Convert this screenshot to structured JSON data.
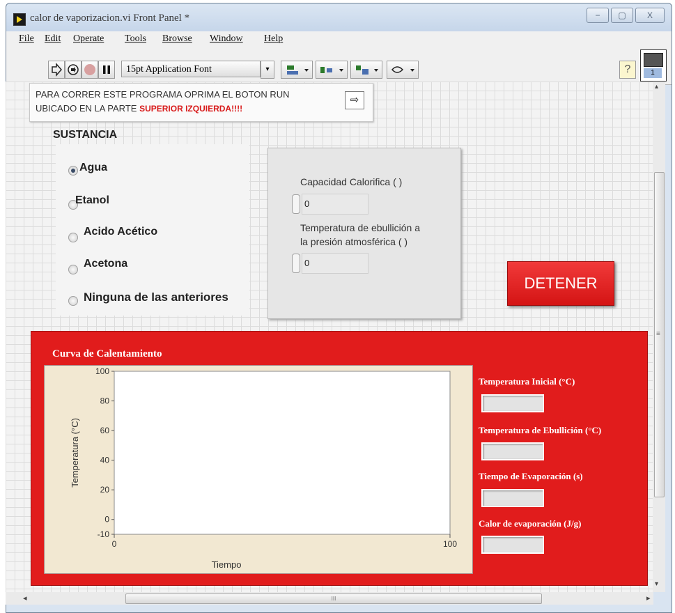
{
  "window": {
    "title": "calor de vaporizacion.vi Front Panel *",
    "controls": {
      "minimize": "−",
      "maximize": "▢",
      "close": "X"
    }
  },
  "menu": [
    "File",
    "Edit",
    "Operate",
    "Tools",
    "Browse",
    "Window",
    "Help"
  ],
  "toolbar": {
    "font_select": "15pt Application Font",
    "help_glyph": "?",
    "vi_icon_text": "1"
  },
  "instructions": {
    "line1": "PARA CORRER ESTE PROGRAMA OPRIMA EL BOTON RUN",
    "line2_prefix": "UBICADO EN LA PARTE ",
    "line2_highlight": "SUPERIOR IZQUIERDA!!!!",
    "arrow_glyph": "⇨"
  },
  "sustancia": {
    "title": "SUSTANCIA",
    "options": [
      "Agua",
      "Etanol",
      "Acido Acético",
      "Acetona",
      "Ninguna de las anteriores"
    ],
    "selected": 0
  },
  "properties": {
    "capacidad_label": "Capacidad Calorifica ( )",
    "capacidad_value": "0",
    "temp_label_1": "Temperatura de ebullición a",
    "temp_label_2": "la presión atmosférica ( )",
    "temp_value": "0"
  },
  "stop_button": {
    "label": "DETENER",
    "color": "#e21f1f"
  },
  "results_panel": {
    "bg_color": "#e11c1c",
    "chart_title": "Curva de Calentamiento",
    "fields": [
      {
        "label": "Temperatura Inicial (°C)",
        "value": ""
      },
      {
        "label": "Temperatura de Ebullición (°C)",
        "value": ""
      },
      {
        "label": "Tiempo de Evaporación (s)",
        "value": ""
      },
      {
        "label": "Calor de evaporación (J/g)",
        "value": ""
      }
    ]
  },
  "chart_data": {
    "type": "line",
    "title": "",
    "xlabel": "Tiempo",
    "ylabel": "Temperatura (°C)",
    "xlim": [
      0,
      100
    ],
    "ylim": [
      -10,
      100
    ],
    "x_ticks": [
      "0",
      "100"
    ],
    "y_ticks": [
      "100",
      "80",
      "60",
      "40",
      "20",
      "0",
      "-10"
    ],
    "series": []
  },
  "scrollbar": {
    "h_thumb": "III",
    "left_arrow": "◂",
    "right_arrow": "▸",
    "up_arrow": "▴",
    "down_arrow": "▾",
    "mid": "≡"
  }
}
